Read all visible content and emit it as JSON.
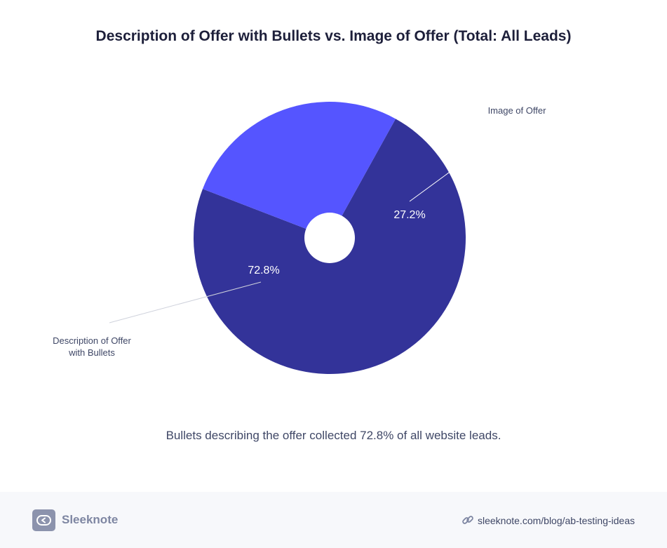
{
  "chart_data": {
    "type": "pie",
    "title": "Description of Offer with Bullets vs. Image of Offer (Total: All Leads)",
    "slices": [
      {
        "label": "Description of Offer with Bullets",
        "label_lines": [
          "Description of Offer",
          "with Bullets"
        ],
        "value": 72.8,
        "value_label": "72.8%",
        "color": "#333399"
      },
      {
        "label": "Image of Offer",
        "label_lines": [
          "Image of Offer"
        ],
        "value": 27.2,
        "value_label": "27.2%",
        "color": "#5555ff"
      }
    ],
    "donut_hole": true,
    "legend": "none"
  },
  "caption": "Bullets describing the offer collected 72.8% of all website leads.",
  "footer": {
    "brand": "Sleeknote",
    "url": "sleeknote.com/blog/ab-testing-ideas",
    "logo_icon": "sleeknote-logo-icon",
    "link_icon": "link-icon",
    "background": "#f7f8fb"
  },
  "colors": {
    "title": "#1d1f3a",
    "text": "#3f4766",
    "leader_line": "#cfd2dc"
  }
}
